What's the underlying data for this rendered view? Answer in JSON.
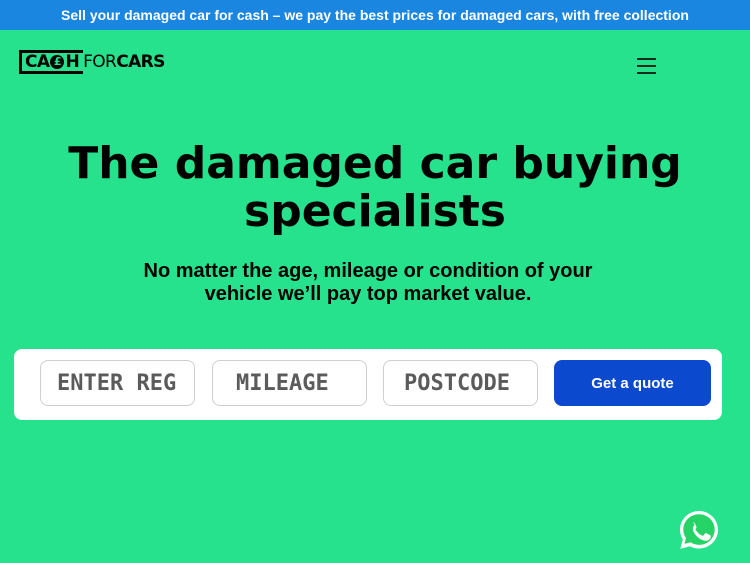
{
  "promo_bar": {
    "text": "Sell your damaged car for cash – we pay the best prices for damaged cars, with free collection"
  },
  "header": {
    "logo": {
      "part1": "CA",
      "pound": "£",
      "part2": "H",
      "for": "FOR",
      "cars": "CARS"
    },
    "menu_icon": "hamburger-icon"
  },
  "hero": {
    "title": "The damaged car buying specialists",
    "subtitle": "No matter the age, mileage or condition of your vehicle we’ll pay top market value."
  },
  "quote_form": {
    "reg_placeholder": "ENTER REG",
    "mileage_placeholder": "MILEAGE",
    "postcode_placeholder": "POSTCODE",
    "submit_label": "Get a quote"
  },
  "colors": {
    "background": "#27e28c",
    "promo_bar": "#1a86e0",
    "button": "#0b49cf",
    "whatsapp": "#25d366"
  },
  "floating": {
    "whatsapp_icon": "whatsapp-icon"
  }
}
